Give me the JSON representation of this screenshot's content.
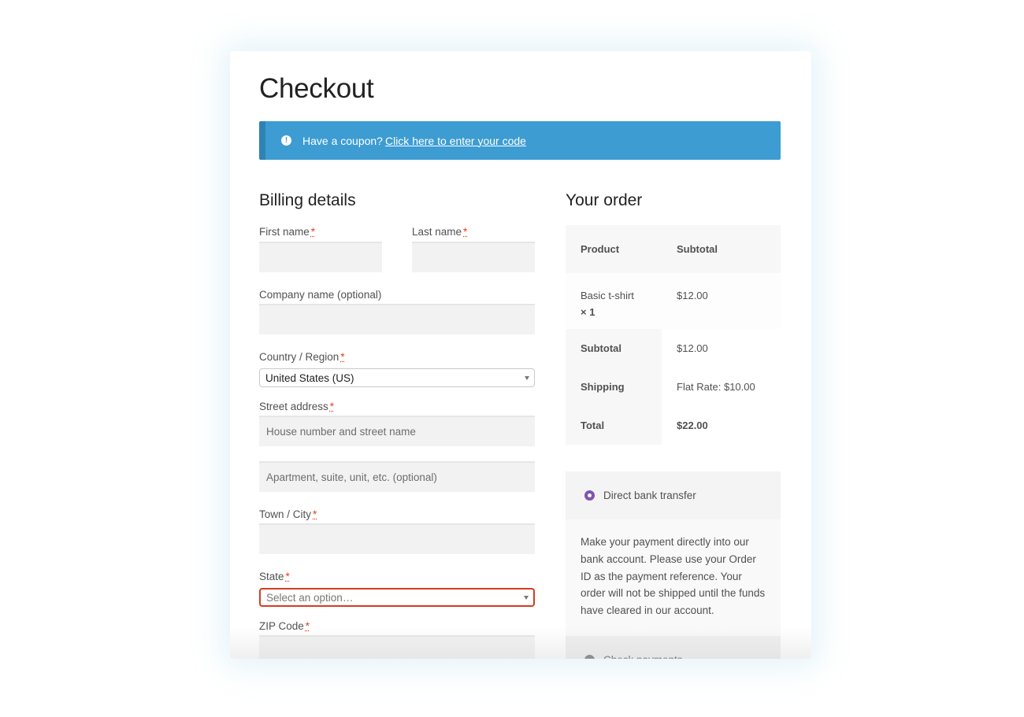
{
  "page": {
    "title": "Checkout"
  },
  "notice": {
    "icon": "info-icon",
    "text": "Have a coupon?",
    "link": "Click here to enter your code",
    "colors": {
      "background": "#3d9cd2",
      "border": "#2f83b4"
    }
  },
  "billing": {
    "title": "Billing details",
    "required_marker": "*",
    "fields": {
      "first_name": {
        "label": "First name",
        "value": "",
        "placeholder": ""
      },
      "last_name": {
        "label": "Last name",
        "value": "",
        "placeholder": ""
      },
      "company": {
        "label": "Company name (optional)",
        "value": "",
        "placeholder": ""
      },
      "country": {
        "label": "Country / Region",
        "selected": "United States (US)"
      },
      "street": {
        "label": "Street address",
        "placeholder": "House number and street name",
        "placeholder2": "Apartment, suite, unit, etc. (optional)"
      },
      "city": {
        "label": "Town / City",
        "value": "",
        "placeholder": ""
      },
      "state": {
        "label": "State",
        "selected": "Select an option…",
        "invalid": true
      },
      "zip": {
        "label": "ZIP Code",
        "value": "",
        "placeholder": ""
      }
    }
  },
  "order": {
    "title": "Your order",
    "headers": {
      "product": "Product",
      "subtotal": "Subtotal"
    },
    "items": [
      {
        "name": "Basic t-shirt",
        "qty": "× 1",
        "price": "$12.00"
      }
    ],
    "totals": [
      {
        "label": "Subtotal",
        "value": "$12.00"
      },
      {
        "label": "Shipping",
        "value": "Flat Rate: $10.00"
      },
      {
        "label": "Total",
        "value": "$22.00"
      }
    ]
  },
  "payment": {
    "methods": [
      {
        "label": "Direct bank transfer",
        "selected": true,
        "description": "Make your payment directly into our bank account. Please use your Order ID as the payment reference. Your order will not be shipped until the funds have cleared in our account."
      },
      {
        "label": "Check payments",
        "selected": false
      }
    ],
    "accent": "#7f54b3"
  },
  "colors": {
    "error": "#d63b1f",
    "required": "#e2401c"
  }
}
